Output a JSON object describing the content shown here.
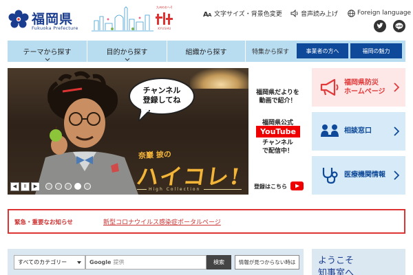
{
  "header": {
    "logo_title": "福岡県",
    "logo_sub": "Fukuoka Prefecture",
    "kyushu_top": "九州のおへそ",
    "kyushu_bottom": "KYUSHU",
    "util_links": {
      "text_size": "文字サイズ・背景色変更",
      "speech": "音声読み上げ",
      "language": "Foreign language"
    }
  },
  "nav": {
    "theme": "テーマから探す",
    "purpose": "目的から探す",
    "organization": "組織から探す",
    "feature_label": "特集から探す",
    "business": "事業者の方へ",
    "charm": "福岡の魅力"
  },
  "slider": {
    "bubble_text": "チャンネル\n登録してね",
    "haikore_small": "奈巖 披の",
    "haikore": "ハイコレ!",
    "high_collection": "High Collection",
    "side_line1": "福岡県だよりを\n動画で紹介！",
    "side_line2": "福岡県公式",
    "youtube_badge": "YouTube",
    "side_line3": "チャンネル\nで配信中！",
    "register": "登録はこちら",
    "prev": "◀",
    "pause": "Ⅱ",
    "next": "▶",
    "slide_count": 5,
    "active_slide": 4
  },
  "cards": {
    "disaster": "福岡県防災\nホームページ",
    "consult": "相談窓口",
    "medical": "医療機関情報"
  },
  "alert": {
    "label": "緊急・重要なお知らせ",
    "link": "新型コロナウイルス感染症ポータルページ"
  },
  "search": {
    "category": "すべてのカテゴリー",
    "input_brand": "Google",
    "input_placeholder": "提供",
    "button": "検索",
    "help": "情報が見つからない時は"
  },
  "welcome": {
    "text": "ようこそ\n知事室へ"
  },
  "colors": {
    "brand_blue": "#1b3d8f",
    "nav_bg": "#b8dcf0",
    "nav_button": "#0f4a9a",
    "alert_red": "#d33",
    "youtube_red": "#e00"
  }
}
